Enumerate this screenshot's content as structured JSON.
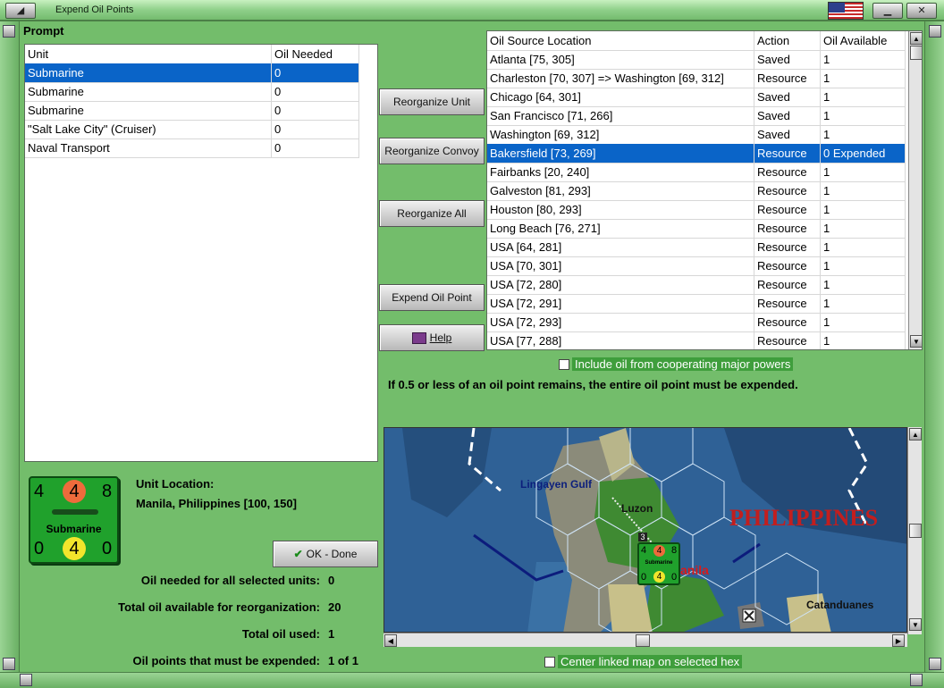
{
  "window": {
    "title": "Expend Oil Points",
    "flag_icon": "usa-flag-icon"
  },
  "prompt": {
    "label": "Prompt",
    "columns": [
      "Unit",
      "Oil Needed"
    ],
    "rows": [
      {
        "unit": "Submarine",
        "oil": "0"
      },
      {
        "unit": "Submarine",
        "oil": "0"
      },
      {
        "unit": "Submarine",
        "oil": "0"
      },
      {
        "unit": "\"Salt Lake City\" (Cruiser)",
        "oil": "0"
      },
      {
        "unit": "Naval Transport",
        "oil": "0"
      }
    ]
  },
  "buttons": {
    "reorganize_unit": "Reorganize Unit",
    "reorganize_convoy": "Reorganize Convoy",
    "reorganize_all": "Reorganize All",
    "expend_oil_point": "Expend Oil Point",
    "help": "Help",
    "ok_done": "OK - Done"
  },
  "sources": {
    "columns": [
      "Oil Source Location",
      "Action",
      "Oil Available"
    ],
    "rows": [
      {
        "loc": "Atlanta [75, 305]",
        "action": "Saved",
        "avail": "1"
      },
      {
        "loc": "Charleston [70, 307] => Washington [69, 312]",
        "action": "Resource",
        "avail": "1"
      },
      {
        "loc": "Chicago [64, 301]",
        "action": "Saved",
        "avail": "1"
      },
      {
        "loc": "San Francisco [71, 266]",
        "action": "Saved",
        "avail": "1"
      },
      {
        "loc": "Washington [69, 312]",
        "action": "Saved",
        "avail": "1"
      },
      {
        "loc": "Bakersfield [73, 269]",
        "action": "Resource",
        "avail": "0 Expended"
      },
      {
        "loc": "Fairbanks [20, 240]",
        "action": "Resource",
        "avail": "1"
      },
      {
        "loc": "Galveston [81, 293]",
        "action": "Resource",
        "avail": "1"
      },
      {
        "loc": "Houston [80, 293]",
        "action": "Resource",
        "avail": "1"
      },
      {
        "loc": "Long Beach [76, 271]",
        "action": "Resource",
        "avail": "1"
      },
      {
        "loc": "USA [64, 281]",
        "action": "Resource",
        "avail": "1"
      },
      {
        "loc": "USA [70, 301]",
        "action": "Resource",
        "avail": "1"
      },
      {
        "loc": "USA [72, 280]",
        "action": "Resource",
        "avail": "1"
      },
      {
        "loc": "USA [72, 291]",
        "action": "Resource",
        "avail": "1"
      },
      {
        "loc": "USA [72, 293]",
        "action": "Resource",
        "avail": "1"
      },
      {
        "loc": "USA [77, 288]",
        "action": "Resource",
        "avail": "1"
      }
    ]
  },
  "include_oil_label": "Include oil from cooperating major powers",
  "rule_text": "If 0.5 or less of an oil point remains, the entire oil point must be expended.",
  "unit_counter": {
    "top_left": "4",
    "top_mid": "4",
    "top_right": "8",
    "name": "Submarine",
    "bot_left": "0",
    "bot_mid": "4",
    "bot_right": "0"
  },
  "unit_location": {
    "label": "Unit Location:",
    "value": "Manila, Philippines [100, 150]"
  },
  "stats": [
    {
      "label": "Oil needed for all selected units:",
      "value": "0"
    },
    {
      "label": "Total oil available for reorganization:",
      "value": "20"
    },
    {
      "label": "Total oil used:",
      "value": "1"
    },
    {
      "label": "Oil points that must be expended:",
      "value": "1 of 1"
    }
  ],
  "map": {
    "labels": {
      "lingayen": "Lingayen Gulf",
      "luzon": "Luzon",
      "philippines": "PHILIPPINES",
      "manila": "anila",
      "catanduanes": "Catanduanes"
    },
    "stack_count": "3",
    "counter": {
      "tl": "4",
      "tm": "4",
      "tr": "8",
      "name": "Submarine",
      "bl": "0",
      "bm": "4",
      "br": "0"
    }
  },
  "center_map_label": "Center linked map on selected hex",
  "colors": {
    "selection": "#0a64c8",
    "panel": "#73bd6b",
    "sea": "#2c5c8e"
  }
}
